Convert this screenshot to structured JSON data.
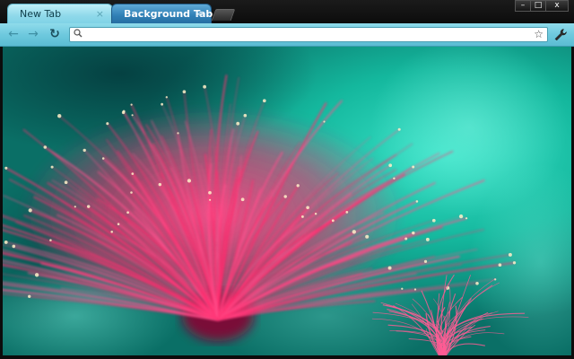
{
  "tabs": [
    {
      "label": "New Tab",
      "close": "×",
      "active": true
    },
    {
      "label": "Background Tab",
      "close": "×",
      "active": false
    }
  ],
  "window_controls": {
    "minimize": "–",
    "maximize": "□",
    "close": "x"
  },
  "toolbar": {
    "back": "←",
    "forward": "→",
    "reload": "↻",
    "omnibox_value": "",
    "star": "☆"
  },
  "icons": [
    "back-arrow-icon",
    "forward-arrow-icon",
    "reload-icon",
    "search-icon",
    "star-icon",
    "wrench-icon"
  ],
  "theme": {
    "tab_active_color": "#8fd9ea",
    "tab_background_color": "#2f7fb5",
    "toolbar_color": "#6ec9de",
    "background_teal": "#0fb59a",
    "flower_pink": "#ff3a78"
  }
}
